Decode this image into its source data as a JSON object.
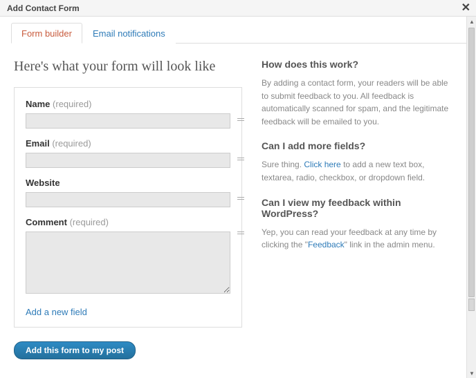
{
  "window": {
    "title": "Add Contact Form"
  },
  "tabs": {
    "builder": "Form builder",
    "email": "Email notifications"
  },
  "preview_heading": "Here's what your form will look like",
  "fields": {
    "name": {
      "label": "Name",
      "req": "(required)"
    },
    "email": {
      "label": "Email",
      "req": "(required)"
    },
    "website": {
      "label": "Website"
    },
    "comment": {
      "label": "Comment",
      "req": "(required)"
    }
  },
  "add_field_link": "Add a new field",
  "submit_label": "Add this form to my post",
  "help": {
    "q1": "How does this work?",
    "a1": "By adding a contact form, your readers will be able to submit feedback to you. All feedback is automatically scanned for spam, and the legitimate feedback will be emailed to you.",
    "q2": "Can I add more fields?",
    "a2_pre": "Sure thing. ",
    "a2_link": "Click here",
    "a2_post": " to add a new text box, textarea, radio, checkbox, or dropdown field.",
    "q3": "Can I view my feedback within WordPress?",
    "a3_pre": "Yep, you can read your feedback at any time by clicking the \"",
    "a3_link": "Feedback",
    "a3_post": "\" link in the admin menu."
  }
}
